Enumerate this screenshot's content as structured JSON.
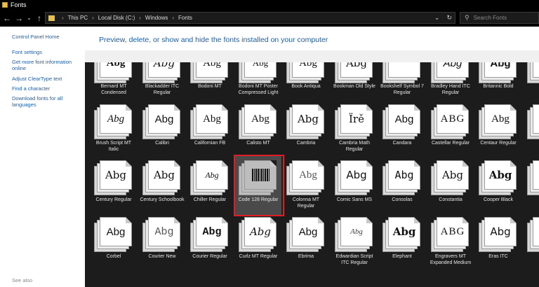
{
  "window": {
    "title": "Fonts"
  },
  "toolbar": {
    "back": "←",
    "forward": "→",
    "recent": "⌄",
    "up": "↑"
  },
  "address": {
    "crumbs": [
      "This PC",
      "Local Disk (C:)",
      "Windows",
      "Fonts"
    ],
    "dropdown": "⌄",
    "refresh": "↻"
  },
  "search": {
    "placeholder": "Search Fonts"
  },
  "sidebar": {
    "links": [
      "Control Panel Home",
      "Font settings",
      "Get more font information online",
      "Adjust ClearType text",
      "Find a character",
      "Download fonts for all languages"
    ],
    "see_also": "See also"
  },
  "header": {
    "title": "Preview, delete, or show and hide the fonts installed on your computer"
  },
  "fonts": [
    {
      "name": "Bernard MT Condensed",
      "sample": "Abg"
    },
    {
      "name": "Blackadder ITC Regular",
      "sample": "Abg"
    },
    {
      "name": "Bodoni MT",
      "sample": "Abg"
    },
    {
      "name": "Bodoni MT Poster Compressed Light",
      "sample": "Abg"
    },
    {
      "name": "Book Antiqua",
      "sample": "Abg"
    },
    {
      "name": "Bookman Old Style",
      "sample": "Abg"
    },
    {
      "name": "Bookshelf Symbol 7 Regular",
      "sample": ""
    },
    {
      "name": "Bradley Hand ITC Regular",
      "sample": "Abg"
    },
    {
      "name": "Britannic Bold",
      "sample": "Abg"
    },
    {
      "name": "B",
      "sample": ""
    },
    {
      "name": "Brush Script MT Italic",
      "sample": "Abg"
    },
    {
      "name": "Calibri",
      "sample": "Abg"
    },
    {
      "name": "Californian FB",
      "sample": "Abg"
    },
    {
      "name": "Calisto MT",
      "sample": "Abg"
    },
    {
      "name": "Cambria",
      "sample": "Abg"
    },
    {
      "name": "Cambria Math Regular",
      "sample": "Ïrě"
    },
    {
      "name": "Candara",
      "sample": "Abg"
    },
    {
      "name": "Castellar Regular",
      "sample": "ABG"
    },
    {
      "name": "Centaur Regular",
      "sample": "Abg"
    },
    {
      "name": "Cent",
      "sample": "Ab"
    },
    {
      "name": "Century Regular",
      "sample": "Abg"
    },
    {
      "name": "Century Schoolbook",
      "sample": "Abg"
    },
    {
      "name": "Chiller Regular",
      "sample": "Abg"
    },
    {
      "name": "Code 128 Regular",
      "sample": ""
    },
    {
      "name": "Colonna MT Regular",
      "sample": "Abg"
    },
    {
      "name": "Comic Sans MS",
      "sample": "Abg"
    },
    {
      "name": "Consolas",
      "sample": "Abg"
    },
    {
      "name": "Constantia",
      "sample": "Abg"
    },
    {
      "name": "Cooper Black",
      "sample": "Abg"
    },
    {
      "name": "Cop",
      "sample": "Ab"
    },
    {
      "name": "Corbel",
      "sample": "Abg"
    },
    {
      "name": "Courier New",
      "sample": "Abg"
    },
    {
      "name": "Courier Regular",
      "sample": "Abg"
    },
    {
      "name": "Curlz MT Regular",
      "sample": "Abg"
    },
    {
      "name": "Ebrima",
      "sample": "Abg"
    },
    {
      "name": "Edwardian Script ITC Regular",
      "sample": "Abg"
    },
    {
      "name": "Elephant",
      "sample": "Abg"
    },
    {
      "name": "Engravers MT Expanded Medium",
      "sample": "ABG"
    },
    {
      "name": "Eras ITC",
      "sample": "Abg"
    },
    {
      "name": "Feli",
      "sample": "Ab"
    }
  ],
  "selected_font": "Code 128 Regular",
  "colors": {
    "accent_link": "#1e5ea8",
    "highlight_box": "#e01d24",
    "grid_bg": "#1c1c1c"
  }
}
